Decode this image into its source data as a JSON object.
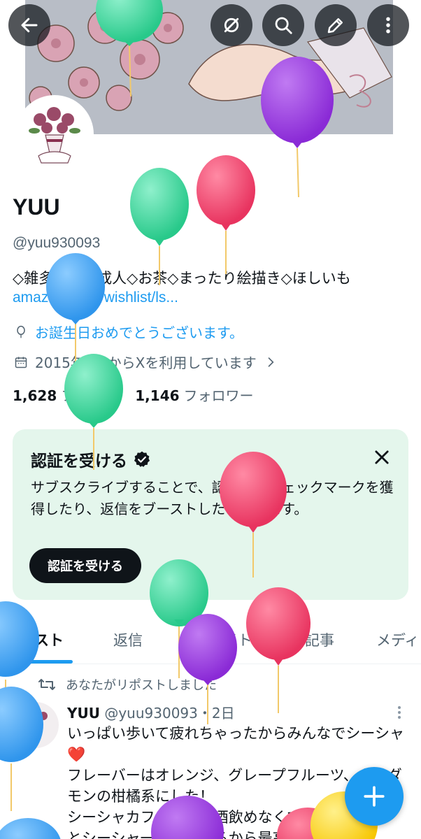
{
  "topbar": {
    "back_icon": "arrow-left-icon",
    "icons": [
      "hide-icon",
      "search-icon",
      "edit-icon",
      "more-vertical-icon"
    ]
  },
  "profile": {
    "name": "YUU",
    "handle": "@yuu930093",
    "bio": "◇雑多に呟く成人◇お茶◇まったり絵描き◇ほしいも",
    "link": "amazon.jp/hz/wishlist/ls...",
    "birthday": "お誕生日おめでとうございます。",
    "joined": "2015年1月からXを利用しています",
    "following_count": "1,628",
    "following_label": "フォロー",
    "followers_count": "1,146",
    "followers_label": "フォロワー"
  },
  "verify": {
    "title": "認証を受ける",
    "body": "サブスクライブすることで、認証済みチェックマークを獲得したり、返信をブーストしたりできます。",
    "button": "認証を受ける"
  },
  "tabs": [
    "ポスト",
    "返信",
    "ハイライト",
    "記事",
    "メディ"
  ],
  "post": {
    "repost_label": "あなたがリポストしました",
    "author": "YUU",
    "handle_time": "@yuu930093・2日",
    "lines": [
      "いっぱい歩いて疲れちゃったからみんなでシーシャ❤️",
      "フレーバーはオレンジ、グレープフルーツ、カルダモンの柑橘系にした！",
      "シーシャカフェだとお酒飲めなくてもスッ",
      "とシーシャ一緒に…れるから最高"
    ]
  },
  "colors": {
    "accent": "#1d9bf0",
    "verify_bg": "#e4f6ec",
    "balloon_green": "#3ddca0",
    "balloon_red": "#f0456e",
    "balloon_purple": "#9a3ae0",
    "balloon_blue": "#3fa6f5",
    "balloon_yellow": "#ffd21f"
  }
}
